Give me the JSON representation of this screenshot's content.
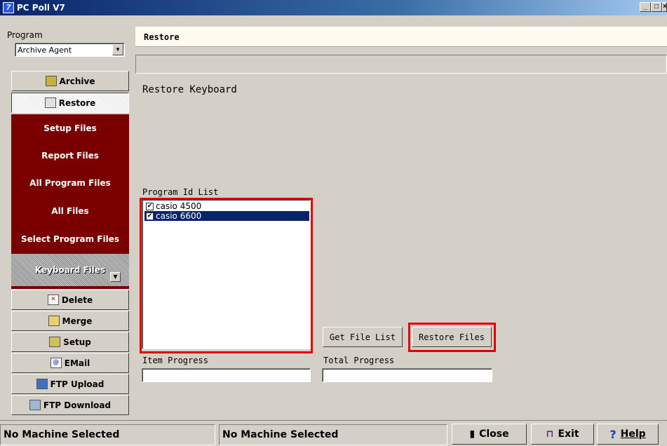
{
  "window": {
    "title": "PC Poll V7",
    "min": "_",
    "max": "□",
    "close": "×"
  },
  "sidebar": {
    "program_label": "Program",
    "program_value": "Archive Agent",
    "buttons_top": [
      {
        "label": "Archive",
        "icon": "archive-icon"
      },
      {
        "label": "Restore",
        "icon": "restore-icon"
      }
    ],
    "restore_options": [
      "Setup Files",
      "Report Files",
      "All Program Files",
      "All Files",
      "Select Program Files",
      "Keyboard Files"
    ],
    "buttons_bottom": [
      {
        "label": "Delete",
        "icon": "delete-icon"
      },
      {
        "label": "Merge",
        "icon": "folder-icon"
      },
      {
        "label": "Setup",
        "icon": "setup-icon"
      },
      {
        "label": "EMail",
        "icon": "email-icon"
      },
      {
        "label": "FTP Upload",
        "icon": "upload-icon"
      },
      {
        "label": "FTP Download",
        "icon": "download-icon"
      }
    ]
  },
  "main": {
    "header": "Restore",
    "heading": "Restore Keyboard",
    "program_id_label": "Program Id List",
    "program_ids": [
      {
        "label": "casio 4500",
        "checked": true
      },
      {
        "label": "casio 6600",
        "checked": true,
        "selected": true
      }
    ],
    "get_file_list": "Get File List",
    "restore_files": "Restore Files",
    "item_progress": "Item Progress",
    "total_progress": "Total Progress"
  },
  "status": {
    "left": "No Machine Selected",
    "middle": "No Machine Selected",
    "close": "Close",
    "exit": "Exit",
    "help": "Help"
  },
  "colors": {
    "accent_red": "#7a0000",
    "highlight": "#e00000",
    "selection": "#0a246a"
  }
}
